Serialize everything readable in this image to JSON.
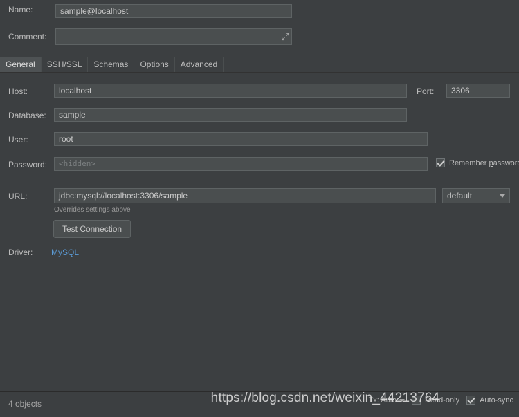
{
  "form": {
    "name": {
      "label": "Name:",
      "value": "sample@localhost"
    },
    "comment": {
      "label": "Comment:",
      "value": "",
      "expand_icon": "expand-icon"
    },
    "host": {
      "label": "Host:",
      "value": "localhost"
    },
    "port": {
      "label": "Port:",
      "value": "3306"
    },
    "database": {
      "label": "Database:",
      "value": "sample"
    },
    "user": {
      "label": "User:",
      "value": "root"
    },
    "password": {
      "label": "Password:",
      "placeholder": "<hidden>",
      "value": ""
    },
    "remember_password": {
      "label_pre": "Remember ",
      "label_mnemonic": "p",
      "label_post": "assword",
      "checked": true
    },
    "url": {
      "label": "URL:",
      "value": "jdbc:mysql://localhost:3306/sample"
    },
    "url_mode": {
      "selected": "default"
    },
    "url_hint": "Overrides settings above",
    "test_connection": "Test Connection",
    "driver": {
      "label": "Driver:",
      "value": "MySQL"
    }
  },
  "tabs": [
    {
      "label": "General",
      "active": true
    },
    {
      "label": "SSH/SSL",
      "active": false
    },
    {
      "label": "Schemas",
      "active": false
    },
    {
      "label": "Options",
      "active": false
    },
    {
      "label": "Advanced",
      "active": false
    }
  ],
  "statusbar": {
    "objects": "4 objects",
    "tx": "Tx: Auto",
    "read_only": {
      "label": "Read-only",
      "checked": false
    },
    "auto_sync": {
      "label": "Auto-sync",
      "checked": true
    }
  },
  "watermark": "https://blog.csdn.net/weixin_44213764",
  "colors": {
    "background": "#3c3f41",
    "field_bg": "#4a4e4f",
    "field_border": "#5e6364",
    "text": "#bbbbbb",
    "link": "#5b9bd5",
    "tab_active_bg": "#4e5254"
  }
}
